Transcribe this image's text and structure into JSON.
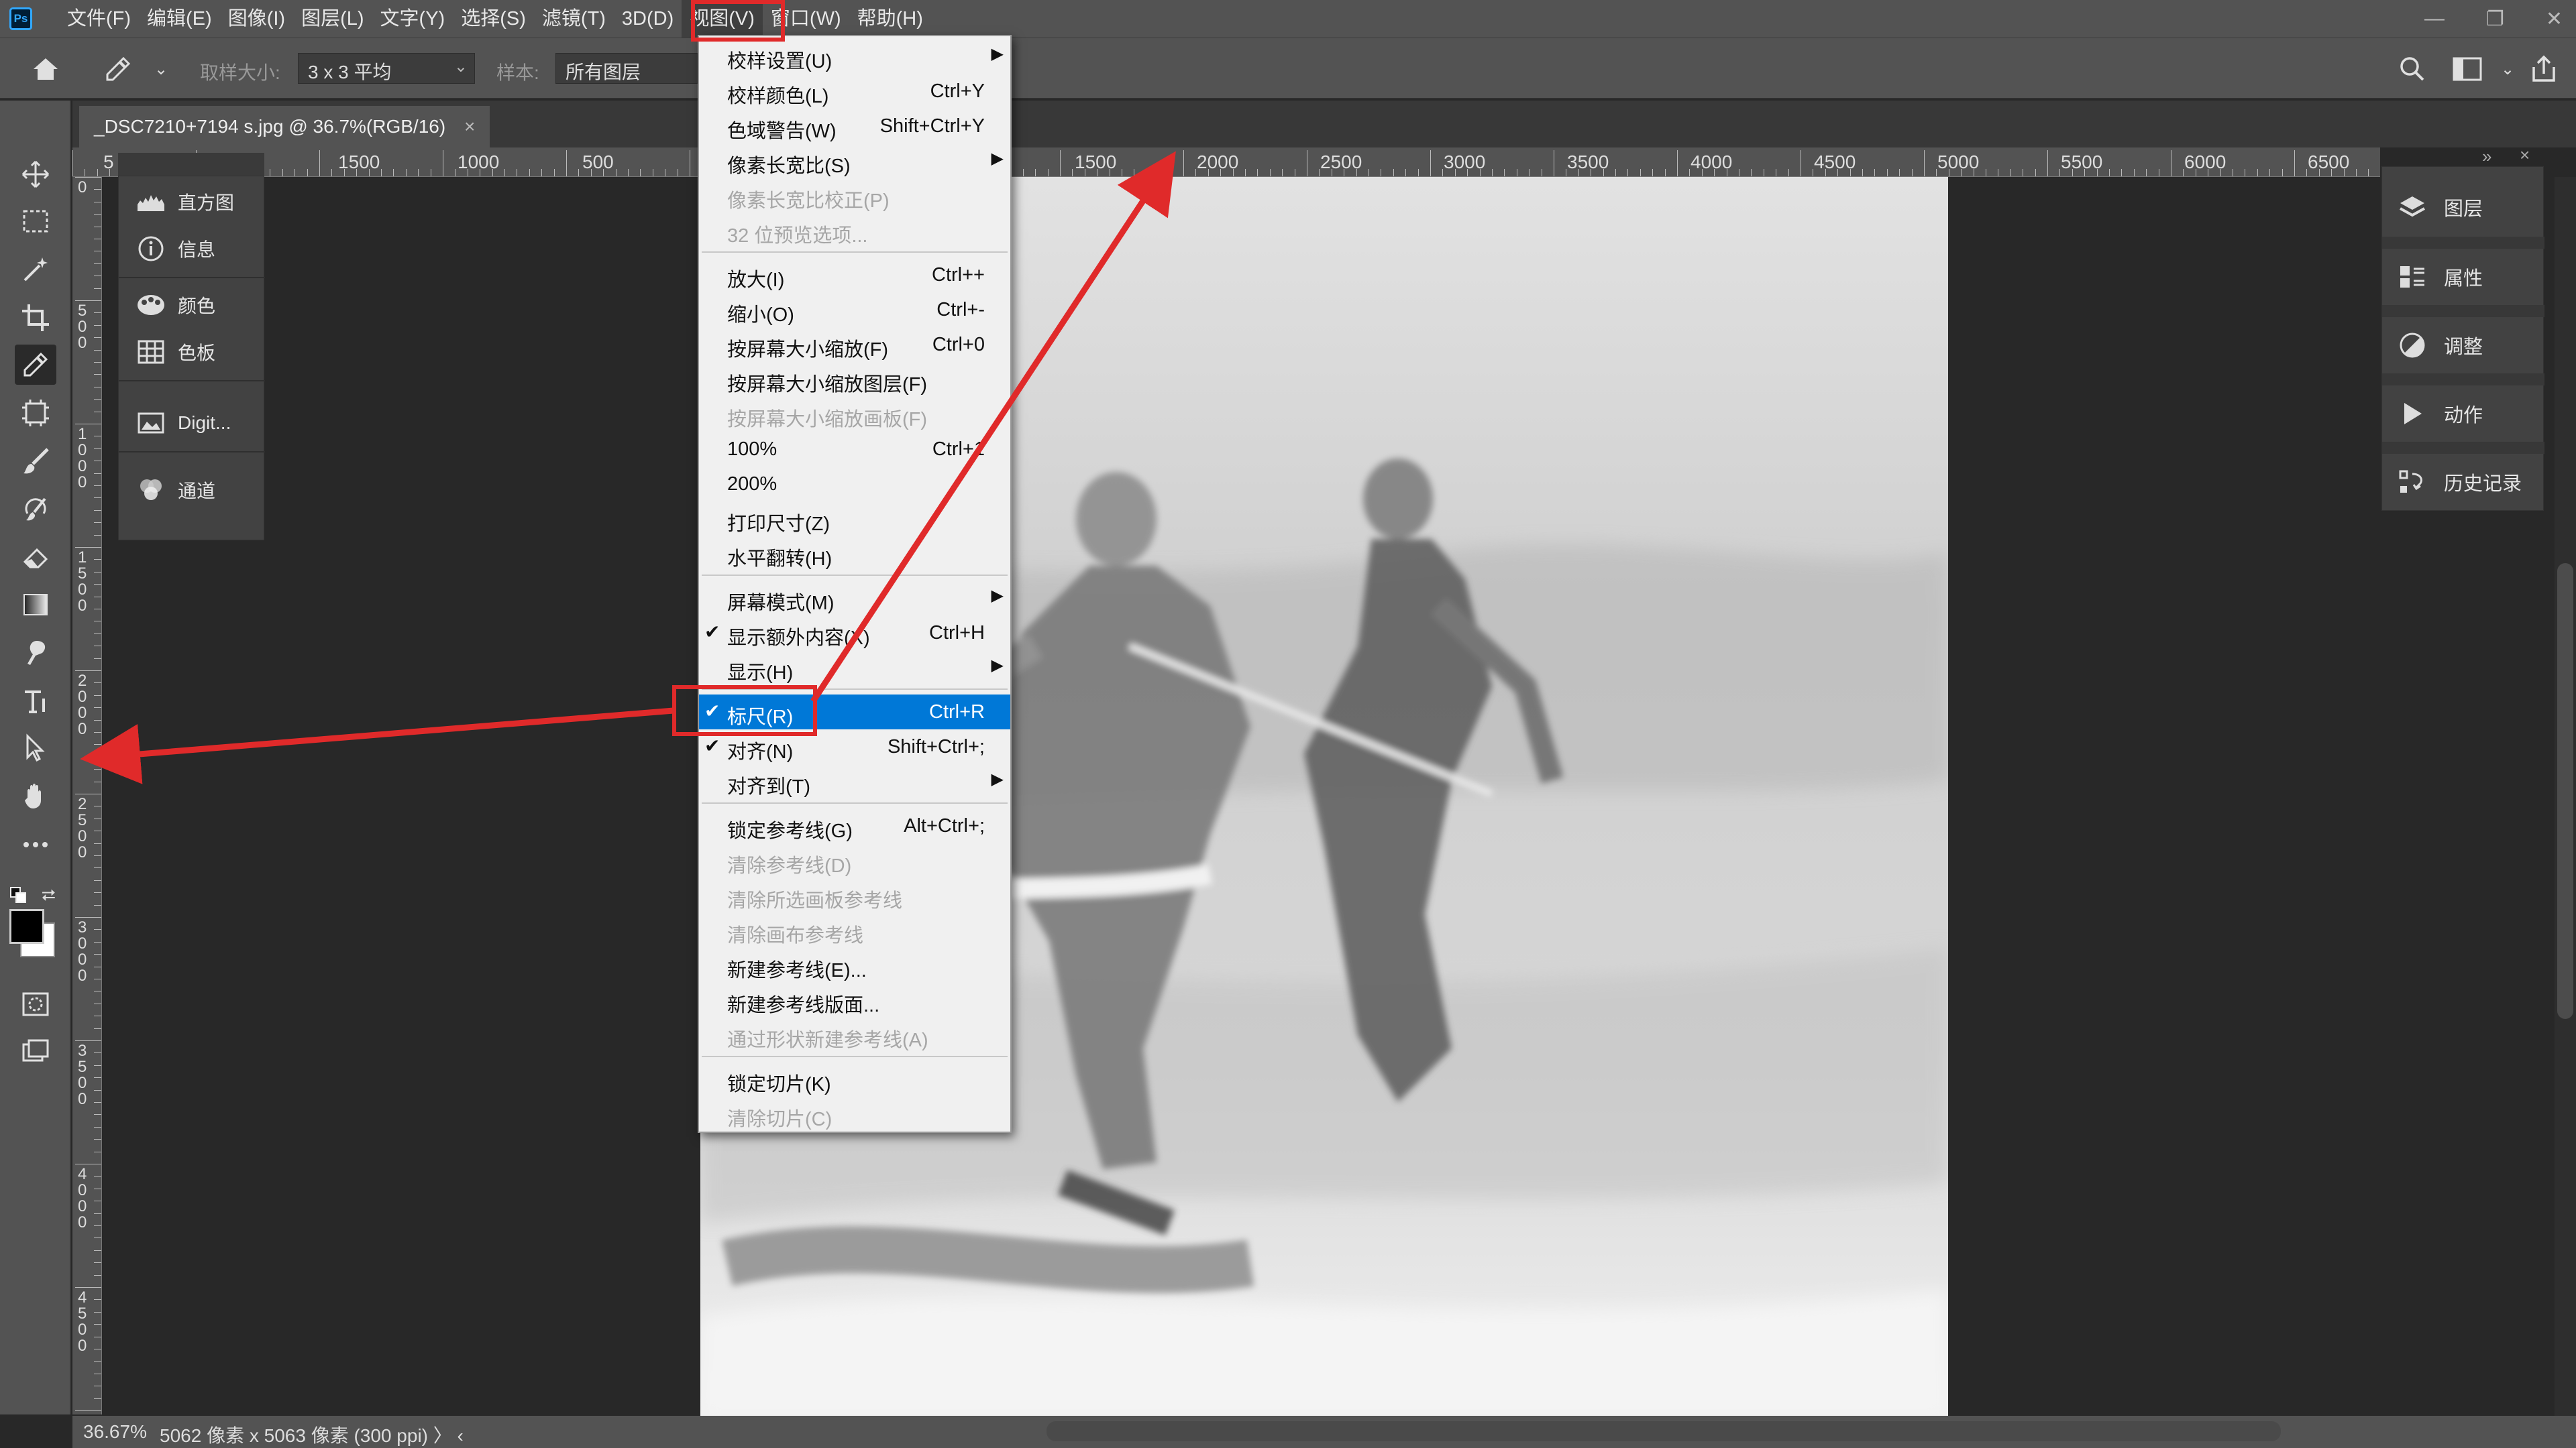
{
  "app": {
    "logo": "Ps"
  },
  "menubar": {
    "items": [
      "文件(F)",
      "编辑(E)",
      "图像(I)",
      "图层(L)",
      "文字(Y)",
      "选择(S)",
      "滤镜(T)",
      "3D(D)",
      "视图(V)",
      "窗口(W)",
      "帮助(H)"
    ],
    "active_index": 8
  },
  "window_controls": {
    "minimize": "—",
    "restore": "❐",
    "close": "✕"
  },
  "options_bar": {
    "sample_size_label": "取样大小:",
    "sample_size_value": "3 x 3 平均",
    "sample_label": "样本:",
    "sample_value": "所有图层"
  },
  "tab": {
    "title": "_DSC7210+7194 s.jpg @ 36.7%(RGB/16)",
    "close": "×"
  },
  "ruler_top": {
    "labels": [
      "5",
      "1500",
      "1000",
      "500",
      "1500",
      "2000",
      "2500",
      "3000",
      "3500",
      "4000",
      "4500",
      "5000",
      "5500",
      "6000",
      "6500"
    ]
  },
  "ruler_left": {
    "labels": [
      "0",
      "5\n0\n0",
      "1\n0\n0\n0",
      "1\n5\n0\n0",
      "2\n0\n0\n0",
      "2\n5\n0\n0",
      "3\n0\n0\n0",
      "3\n5\n0\n0",
      "4\n0\n0\n0",
      "4\n5\n0\n0"
    ]
  },
  "mini_panel": {
    "items": [
      {
        "icon": "histogram-icon",
        "label": "直方图"
      },
      {
        "icon": "info-icon",
        "label": "信息"
      },
      {
        "icon": "color-icon",
        "label": "颜色"
      },
      {
        "icon": "swatches-icon",
        "label": "色板"
      },
      {
        "icon": "digit-icon",
        "label": "Digit..."
      },
      {
        "icon": "channels-icon",
        "label": "通道"
      }
    ]
  },
  "right_panel": {
    "items": [
      {
        "icon": "layers-icon",
        "label": "图层"
      },
      {
        "icon": "properties-icon",
        "label": "属性"
      },
      {
        "icon": "adjustments-icon",
        "label": "调整"
      },
      {
        "icon": "actions-icon",
        "label": "动作"
      },
      {
        "icon": "history-icon",
        "label": "历史记录"
      }
    ]
  },
  "view_menu": {
    "items": [
      {
        "label": "校样设置(U)",
        "shortcut": "",
        "submenu": true
      },
      {
        "label": "校样颜色(L)",
        "shortcut": "Ctrl+Y"
      },
      {
        "label": "色域警告(W)",
        "shortcut": "Shift+Ctrl+Y"
      },
      {
        "label": "像素长宽比(S)",
        "shortcut": "",
        "submenu": true
      },
      {
        "label": "像素长宽比校正(P)",
        "shortcut": "",
        "disabled": true
      },
      {
        "label": "32 位预览选项...",
        "shortcut": "",
        "disabled": true
      },
      {
        "label": "放大(I)",
        "shortcut": "Ctrl++"
      },
      {
        "label": "缩小(O)",
        "shortcut": "Ctrl+-"
      },
      {
        "label": "按屏幕大小缩放(F)",
        "shortcut": "Ctrl+0"
      },
      {
        "label": "按屏幕大小缩放图层(F)",
        "shortcut": ""
      },
      {
        "label": "按屏幕大小缩放画板(F)",
        "shortcut": "",
        "disabled": true
      },
      {
        "label": "100%",
        "shortcut": "Ctrl+1"
      },
      {
        "label": "200%",
        "shortcut": ""
      },
      {
        "label": "打印尺寸(Z)",
        "shortcut": ""
      },
      {
        "label": "水平翻转(H)",
        "shortcut": ""
      },
      {
        "label": "屏幕模式(M)",
        "shortcut": "",
        "submenu": true
      },
      {
        "label": "显示额外内容(X)",
        "shortcut": "Ctrl+H",
        "checked": true
      },
      {
        "label": "显示(H)",
        "shortcut": "",
        "submenu": true
      },
      {
        "label": "标尺(R)",
        "shortcut": "Ctrl+R",
        "checked": true,
        "highlighted": true
      },
      {
        "label": "对齐(N)",
        "shortcut": "Shift+Ctrl+;",
        "checked": true
      },
      {
        "label": "对齐到(T)",
        "shortcut": "",
        "submenu": true
      },
      {
        "label": "锁定参考线(G)",
        "shortcut": "Alt+Ctrl+;"
      },
      {
        "label": "清除参考线(D)",
        "shortcut": "",
        "disabled": true
      },
      {
        "label": "清除所选画板参考线",
        "shortcut": "",
        "disabled": true
      },
      {
        "label": "清除画布参考线",
        "shortcut": "",
        "disabled": true
      },
      {
        "label": "新建参考线(E)...",
        "shortcut": ""
      },
      {
        "label": "新建参考线版面...",
        "shortcut": ""
      },
      {
        "label": "通过形状新建参考线(A)",
        "shortcut": "",
        "disabled": true
      },
      {
        "label": "锁定切片(K)",
        "shortcut": ""
      },
      {
        "label": "清除切片(C)",
        "shortcut": "",
        "disabled": true
      }
    ]
  },
  "status": {
    "zoom": "36.67%",
    "info": "5062 像素 x 5063 像素 (300 ppi)  〉  ‹"
  },
  "colors": {
    "accent_highlight": "#0078d7",
    "annotation_red": "#e02a2a"
  }
}
